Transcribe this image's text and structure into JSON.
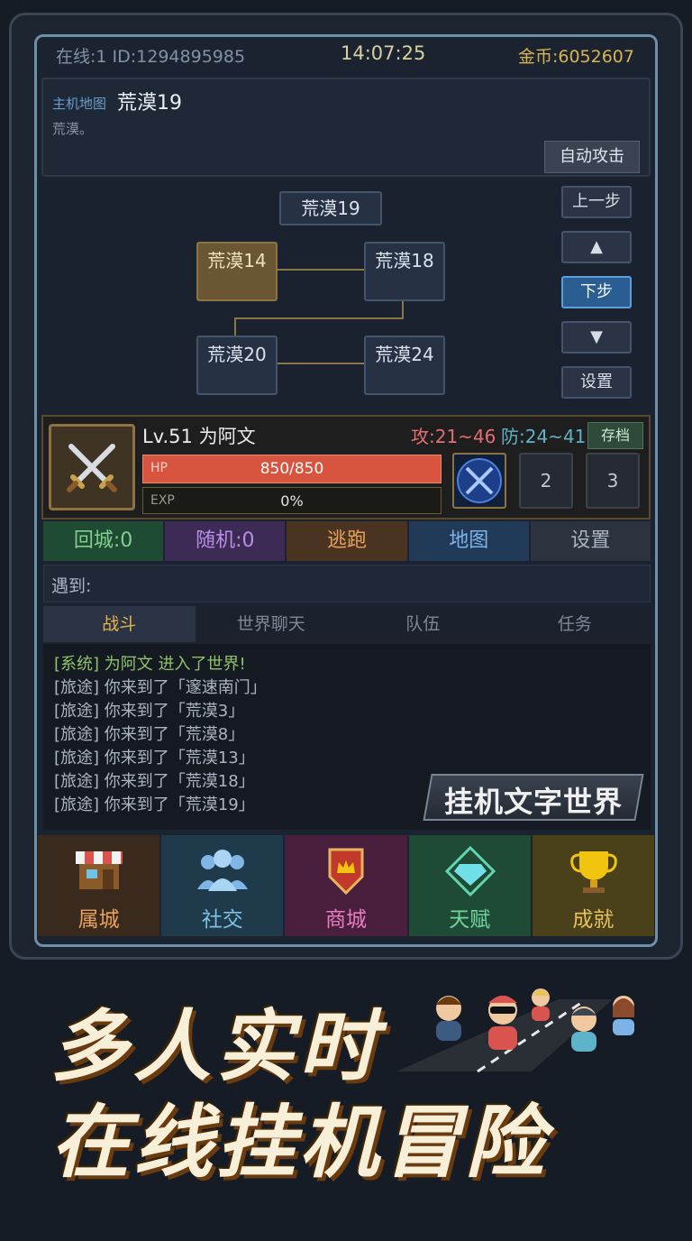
{
  "status": {
    "online_id": "在线:1 ID:1294895985",
    "clock": "14:07:25",
    "gold": "金币:6052607"
  },
  "location": {
    "tag": "主机地图",
    "name": "荒漠19",
    "desc": "荒漠。",
    "auto_attack": "自动攻击"
  },
  "map": {
    "current": "荒漠19",
    "nodes": [
      "荒漠14",
      "荒漠18",
      "荒漠20",
      "荒漠24"
    ],
    "side_buttons": {
      "prev_step": "上一步",
      "up": "▲",
      "next_step": "下步",
      "down": "▼",
      "settings": "设置"
    }
  },
  "character": {
    "level_name": "Lv.51 为阿文",
    "attack": "攻:21~46",
    "defense": "防:24~41",
    "save": "存档",
    "hp_label": "HP",
    "hp_value": "850/850",
    "hp_fraction": 1.0,
    "exp_label": "EXP",
    "exp_value": "0%",
    "exp_fraction": 0.0,
    "skill_slots": [
      "2",
      "3"
    ]
  },
  "actions": [
    {
      "label": "回城:0",
      "bg": "#1f4a33",
      "fg": "#7fd08e"
    },
    {
      "label": "随机:0",
      "bg": "#3d2a55",
      "fg": "#b88ee6"
    },
    {
      "label": "逃跑",
      "bg": "#4a3320",
      "fg": "#e6a15c"
    },
    {
      "label": "地图",
      "bg": "#213a57",
      "fg": "#7db3e6"
    },
    {
      "label": "设置",
      "bg": "#2c333e",
      "fg": "#aab5c2"
    }
  ],
  "encounter": {
    "label": "遇到:"
  },
  "tabs": [
    "战斗",
    "世界聊天",
    "队伍",
    "任务"
  ],
  "log": [
    "[系统] 为阿文 进入了世界!",
    "[旅途] 你来到了「邃速南门」",
    "[旅途] 你来到了「荒漠3」",
    "[旅途] 你来到了「荒漠8」",
    "[旅途] 你来到了「荒漠13」",
    "[旅途] 你来到了「荒漠18」",
    "[旅途] 你来到了「荒漠19」"
  ],
  "brand": "挂机文字世界",
  "nav": [
    {
      "label": "属城",
      "icon": "shop-icon",
      "bg": "#3a2a1e",
      "fg": "#e6a15c"
    },
    {
      "label": "社交",
      "icon": "people-icon",
      "bg": "#1f3a4a",
      "fg": "#7dc1e6"
    },
    {
      "label": "商城",
      "icon": "crown-shield-icon",
      "bg": "#4a1f3d",
      "fg": "#e67dbf"
    },
    {
      "label": "天赋",
      "icon": "diamond-icon",
      "bg": "#1f4a36",
      "fg": "#6fd6a0"
    },
    {
      "label": "成就",
      "icon": "trophy-icon",
      "bg": "#4a401a",
      "fg": "#e6c35c"
    }
  ],
  "promo": {
    "line1": "多人实时",
    "line2": "在线挂机冒险"
  }
}
